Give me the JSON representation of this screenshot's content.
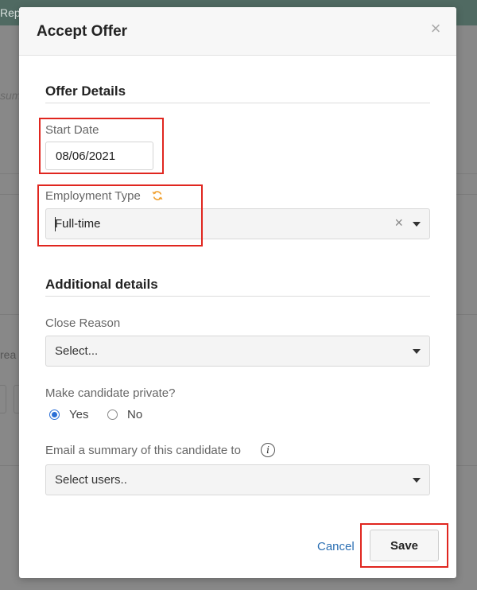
{
  "background": {
    "topbar_text": "Rep",
    "text_1": "sum",
    "text_2": "rea"
  },
  "modal": {
    "title": "Accept Offer",
    "close_icon": "close-icon",
    "offer_details": {
      "heading": "Offer Details",
      "start_date_label": "Start Date",
      "start_date_value": "08/06/2021",
      "employment_type_label": "Employment Type",
      "employment_type_icon": "refresh-icon",
      "employment_type_value": "Full-time",
      "clear_glyph": "×"
    },
    "additional_details": {
      "heading": "Additional details",
      "close_reason_label": "Close Reason",
      "close_reason_placeholder": "Select...",
      "private_label": "Make candidate private?",
      "private_options": [
        "Yes",
        "No"
      ],
      "private_selected": "Yes",
      "email_label": "Email a summary of this candidate to",
      "email_info_glyph": "i",
      "email_placeholder": "Select users.."
    },
    "footer": {
      "cancel_label": "Cancel",
      "save_label": "Save"
    }
  },
  "colors": {
    "accent_link": "#2b6fb3",
    "radio_selected": "#2b6fd6",
    "highlight_annotation": "#e0261f",
    "refresh_icon": "#f0a030"
  }
}
